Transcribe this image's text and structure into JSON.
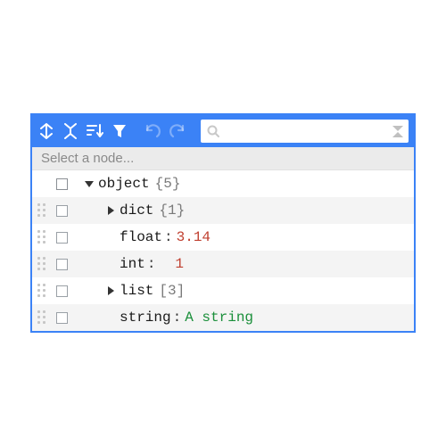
{
  "colors": {
    "accent": "#3b82f6",
    "numberValue": "#c04030",
    "stringValue": "#1a8f3a",
    "muted": "#8a8a8a"
  },
  "toolbar": {
    "expandAll": "expand-all",
    "collapseAll": "collapse-all",
    "sort": "sort",
    "filter": "filter",
    "undo": "undo",
    "redo": "redo"
  },
  "search": {
    "placeholder": "",
    "value": ""
  },
  "breadcrumb": "Select a node...",
  "tree": {
    "root": {
      "label": "object",
      "count": "{5}",
      "expanded": true
    },
    "rows": [
      {
        "key": "dict",
        "kind": "branch",
        "count": "{1}",
        "expanded": false
      },
      {
        "key": "float",
        "kind": "number",
        "value": "3.14"
      },
      {
        "key": "int",
        "kind": "number",
        "value": "1"
      },
      {
        "key": "list",
        "kind": "branch",
        "count": "[3]",
        "expanded": false
      },
      {
        "key": "string",
        "kind": "string",
        "value": "A string"
      }
    ]
  }
}
